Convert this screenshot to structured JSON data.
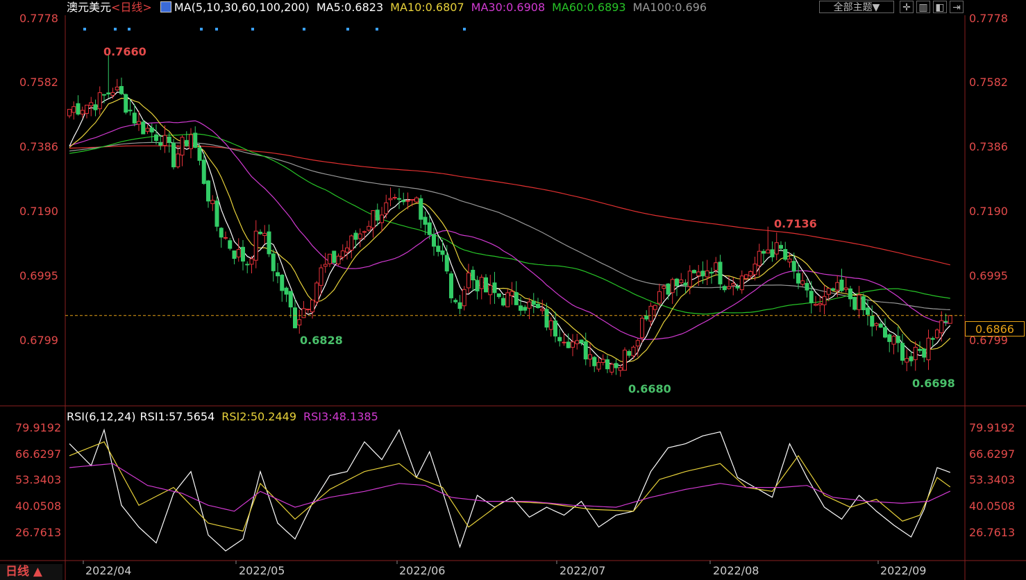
{
  "header": {
    "symbol": "澳元美元",
    "period": "<日线>",
    "ma_params": "MA(5,10,30,60,100,200)",
    "ma5": "MA5:0.6823",
    "ma10": "MA10:0.6807",
    "ma30": "MA30:0.6908",
    "ma60": "MA60:0.6893",
    "ma100": "MA100:0.696",
    "theme_button": "全部主题▼"
  },
  "colors": {
    "up": "#e8323a",
    "down": "#33cc66",
    "ma5": "#ffffff",
    "ma10": "#e8d23a",
    "ma30": "#d23ad2",
    "ma60": "#27c427",
    "ma100": "#999999",
    "ma200": "#e03030",
    "rsi1": "#ffffff",
    "rsi2": "#e8d23a",
    "rsi3": "#d23ad2",
    "axis_label": "#e34a4a"
  },
  "price_axis": [
    "0.7778",
    "0.7582",
    "0.7386",
    "0.7190",
    "0.6995",
    "0.6799"
  ],
  "current_price": "0.6866",
  "annotations": {
    "high": "0.7660",
    "low1": "0.6828",
    "low2": "0.6680",
    "mid_high": "0.7136",
    "low3": "0.6698"
  },
  "rsi_header": {
    "params": "RSI(6,12,24)",
    "rsi1": "RSI1:57.5654",
    "rsi2": "RSI2:50.2449",
    "rsi3": "RSI3:48.1385"
  },
  "rsi_axis": [
    "79.9192",
    "66.6297",
    "53.3403",
    "40.0508",
    "26.7613"
  ],
  "x_axis": [
    "2022/04",
    "2022/05",
    "2022/06",
    "2022/07",
    "2022/08",
    "2022/09"
  ],
  "period_selector": "日线 ▲",
  "chart_data": [
    {
      "type": "candlestick",
      "title": "澳元美元",
      "ylim": [
        0.664,
        0.7778
      ],
      "anchors_close": [
        [
          0,
          0.7493
        ],
        [
          7,
          0.752
        ],
        [
          10,
          0.7556
        ],
        [
          12,
          0.753
        ],
        [
          16,
          0.7445
        ],
        [
          21,
          0.741
        ],
        [
          24,
          0.734
        ],
        [
          28,
          0.742
        ],
        [
          31,
          0.728
        ],
        [
          34,
          0.714
        ],
        [
          38,
          0.706
        ],
        [
          41,
          0.703
        ],
        [
          44,
          0.713
        ],
        [
          48,
          0.698
        ],
        [
          52,
          0.685
        ],
        [
          55,
          0.691
        ],
        [
          58,
          0.7
        ],
        [
          62,
          0.705
        ],
        [
          66,
          0.71
        ],
        [
          70,
          0.717
        ],
        [
          74,
          0.72
        ],
        [
          77,
          0.719
        ],
        [
          80,
          0.722
        ],
        [
          83,
          0.712
        ],
        [
          86,
          0.704
        ],
        [
          89,
          0.688
        ],
        [
          92,
          0.699
        ],
        [
          96,
          0.694
        ],
        [
          100,
          0.692
        ],
        [
          104,
          0.691
        ],
        [
          108,
          0.688
        ],
        [
          111,
          0.683
        ],
        [
          114,
          0.681
        ],
        [
          117,
          0.677
        ],
        [
          121,
          0.674
        ],
        [
          124,
          0.673
        ],
        [
          127,
          0.672
        ],
        [
          130,
          0.679
        ],
        [
          133,
          0.688
        ],
        [
          137,
          0.696
        ],
        [
          141,
          0.696
        ],
        [
          145,
          0.699
        ],
        [
          148,
          0.702
        ],
        [
          151,
          0.697
        ],
        [
          155,
          0.698
        ],
        [
          158,
          0.702
        ],
        [
          161,
          0.707
        ],
        [
          164,
          0.706
        ],
        [
          167,
          0.699
        ],
        [
          170,
          0.692
        ],
        [
          173,
          0.689
        ],
        [
          176,
          0.694
        ],
        [
          179,
          0.693
        ],
        [
          182,
          0.69
        ],
        [
          185,
          0.684
        ],
        [
          188,
          0.68
        ],
        [
          191,
          0.677
        ],
        [
          194,
          0.673
        ],
        [
          197,
          0.676
        ],
        [
          200,
          0.684
        ],
        [
          203,
          0.6866
        ]
      ],
      "high_point": 0.766,
      "low_points": [
        0.6828,
        0.668,
        0.6698
      ]
    },
    {
      "type": "line",
      "title": "RSI(6,12,24)",
      "ylim": [
        20,
        85
      ],
      "series": [
        {
          "name": "RSI1",
          "anchors": [
            [
              0,
              72
            ],
            [
              5,
              61
            ],
            [
              8,
              79
            ],
            [
              12,
              41
            ],
            [
              16,
              30
            ],
            [
              20,
              22
            ],
            [
              24,
              47
            ],
            [
              28,
              58
            ],
            [
              32,
              26
            ],
            [
              36,
              18
            ],
            [
              40,
              24
            ],
            [
              44,
              58
            ],
            [
              48,
              32
            ],
            [
              52,
              24
            ],
            [
              56,
              42
            ],
            [
              60,
              56
            ],
            [
              64,
              58
            ],
            [
              68,
              73
            ],
            [
              72,
              64
            ],
            [
              76,
              79
            ],
            [
              80,
              55
            ],
            [
              83,
              68
            ],
            [
              86,
              48
            ],
            [
              90,
              20
            ],
            [
              94,
              46
            ],
            [
              98,
              40
            ],
            [
              102,
              45
            ],
            [
              106,
              35
            ],
            [
              110,
              40
            ],
            [
              114,
              36
            ],
            [
              118,
              43
            ],
            [
              122,
              30
            ],
            [
              126,
              36
            ],
            [
              130,
              38
            ],
            [
              134,
              58
            ],
            [
              138,
              70
            ],
            [
              142,
              72
            ],
            [
              146,
              76
            ],
            [
              150,
              78
            ],
            [
              154,
              55
            ],
            [
              158,
              50
            ],
            [
              162,
              45
            ],
            [
              166,
              72
            ],
            [
              170,
              55
            ],
            [
              174,
              40
            ],
            [
              178,
              34
            ],
            [
              182,
              46
            ],
            [
              186,
              38
            ],
            [
              190,
              31
            ],
            [
              194,
              25
            ],
            [
              197,
              39
            ],
            [
              200,
              60
            ],
            [
              203,
              57.5654
            ]
          ]
        },
        {
          "name": "RSI2",
          "anchors": [
            [
              0,
              66
            ],
            [
              8,
              73
            ],
            [
              16,
              41
            ],
            [
              24,
              50
            ],
            [
              32,
              32
            ],
            [
              40,
              28
            ],
            [
              44,
              52
            ],
            [
              52,
              34
            ],
            [
              60,
              49
            ],
            [
              68,
              58
            ],
            [
              76,
              62
            ],
            [
              80,
              55
            ],
            [
              86,
              50
            ],
            [
              92,
              30
            ],
            [
              100,
              43
            ],
            [
              110,
              42
            ],
            [
              120,
              39
            ],
            [
              130,
              38
            ],
            [
              136,
              54
            ],
            [
              142,
              58
            ],
            [
              150,
              62
            ],
            [
              156,
              50
            ],
            [
              162,
              48
            ],
            [
              168,
              66
            ],
            [
              174,
              46
            ],
            [
              180,
              40
            ],
            [
              186,
              44
            ],
            [
              192,
              33
            ],
            [
              196,
              36
            ],
            [
              200,
              55
            ],
            [
              203,
              50.2449
            ]
          ]
        },
        {
          "name": "RSI3",
          "anchors": [
            [
              0,
              60
            ],
            [
              10,
              62
            ],
            [
              18,
              51
            ],
            [
              26,
              47
            ],
            [
              32,
              41
            ],
            [
              38,
              38
            ],
            [
              44,
              48
            ],
            [
              52,
              40
            ],
            [
              60,
              45
            ],
            [
              68,
              48
            ],
            [
              76,
              52
            ],
            [
              82,
              51
            ],
            [
              88,
              45
            ],
            [
              96,
              43
            ],
            [
              106,
              43
            ],
            [
              116,
              41
            ],
            [
              126,
              40
            ],
            [
              134,
              45
            ],
            [
              142,
              49
            ],
            [
              150,
              52
            ],
            [
              156,
              50
            ],
            [
              164,
              50
            ],
            [
              170,
              51
            ],
            [
              176,
              45
            ],
            [
              184,
              43
            ],
            [
              192,
              42
            ],
            [
              198,
              43
            ],
            [
              203,
              48.1385
            ]
          ]
        }
      ]
    }
  ]
}
